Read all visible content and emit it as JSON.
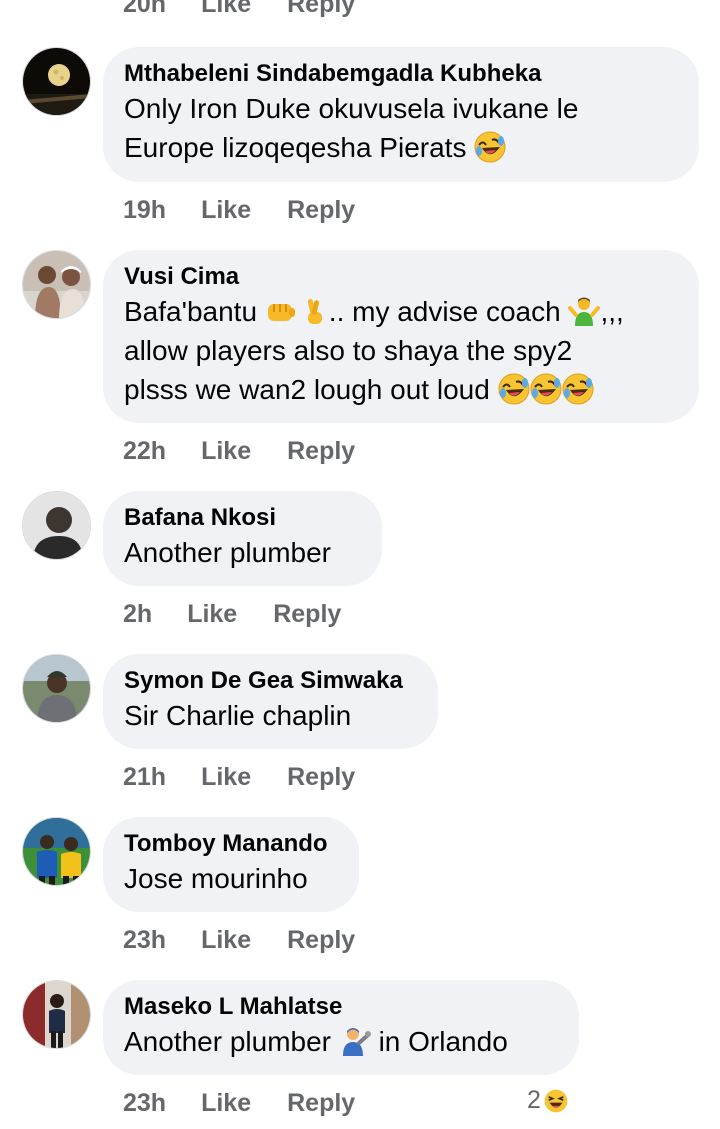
{
  "top_meta": {
    "time": "20h",
    "like": "Like",
    "reply": "Reply"
  },
  "comments": [
    {
      "name": "Mthabeleni Sindabemgadla Kubheka",
      "lines": [
        "Only Iron Duke okuvusela ivukane le",
        "Europe lizoqeqesha Pierats"
      ],
      "time": "19h",
      "like": "Like",
      "reply": "Reply"
    },
    {
      "name": "Vusi Cima",
      "lines": [
        "Bafa'bantu",
        ".. my advise coach",
        ",,,",
        "allow players also to shaya the spy2",
        "plsss we wan2 lough out loud"
      ],
      "time": "22h",
      "like": "Like",
      "reply": "Reply"
    },
    {
      "name": "Bafana Nkosi",
      "lines": [
        "Another plumber"
      ],
      "time": "2h",
      "like": "Like",
      "reply": "Reply"
    },
    {
      "name": "Symon De Gea Simwaka",
      "lines": [
        "Sir Charlie chaplin"
      ],
      "time": "21h",
      "like": "Like",
      "reply": "Reply"
    },
    {
      "name": "Tomboy Manando",
      "lines": [
        "Jose mourinho"
      ],
      "time": "23h",
      "like": "Like",
      "reply": "Reply"
    },
    {
      "name": "Maseko L Mahlatse",
      "lines": [
        "Another plumber",
        "in Orlando"
      ],
      "time": "23h",
      "like": "Like",
      "reply": "Reply",
      "reaction_count": "2"
    }
  ],
  "icons": {
    "laughing": "rolling-on-floor-laughing-emoji",
    "fist": "oncoming-fist-emoji",
    "fingers": "crossed-fingers-emoji",
    "shrug": "person-shrugging-emoji",
    "plumber": "mechanic-emoji",
    "haha": "haha-reaction-icon"
  }
}
